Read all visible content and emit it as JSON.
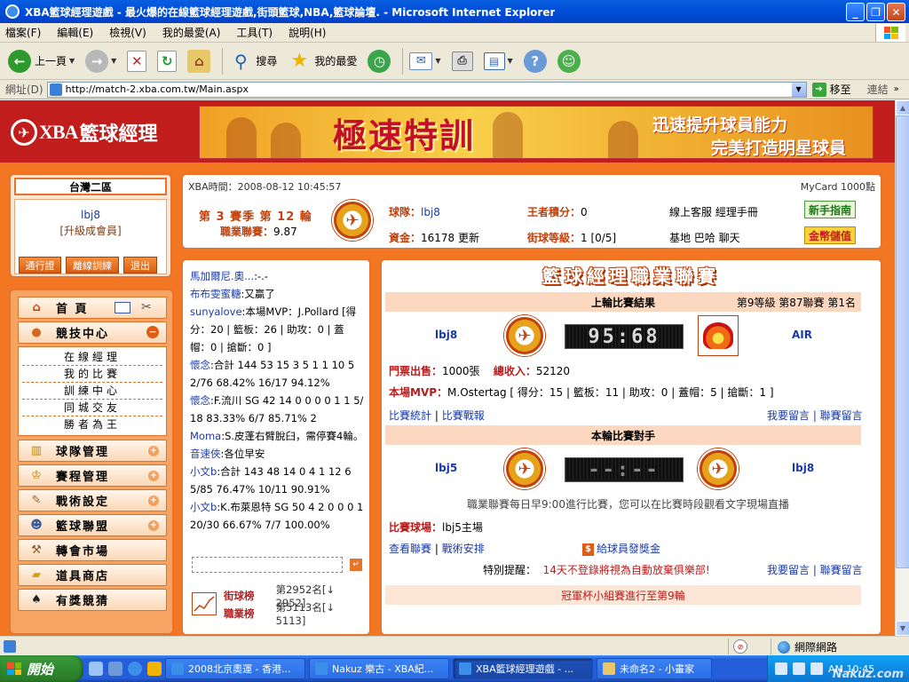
{
  "window": {
    "title": "XBA籃球經理遊戲 - 最火爆的在線籃球經理遊戲,街頭籃球,NBA,籃球論壇. - Microsoft Internet Explorer",
    "controls": [
      "_",
      "❐",
      "✕"
    ]
  },
  "menu": [
    "檔案(F)",
    "編輯(E)",
    "檢視(V)",
    "我的最愛(A)",
    "工具(T)",
    "說明(H)"
  ],
  "toolbar": {
    "back": "上一頁",
    "search": "搜尋",
    "favorites": "我的最愛"
  },
  "address": {
    "label": "網址(D)",
    "url": "http://match-2.xba.com.tw/Main.aspx",
    "go": "移至",
    "links": "連結"
  },
  "banner": {
    "logo_a": "XBA",
    "logo_b": "籃球經理",
    "ad_title": "極速特訓",
    "ad_line1": "迅速提升球員能力",
    "ad_line2": "完美打造明星球員"
  },
  "user": {
    "server": "台灣二區",
    "name": "lbj8",
    "level": "[升級成會員]",
    "buttons": [
      "通行證",
      "離線訓練",
      "退出"
    ]
  },
  "nav": {
    "home": "首 頁",
    "arena": "競技中心",
    "sub": [
      "在線經理",
      "我的比賽",
      "訓練中心",
      "同城交友",
      "勝者為王"
    ],
    "items": [
      "球隊管理",
      "賽程管理",
      "戰術設定",
      "籃球聯盟",
      "轉會市場",
      "道具商店",
      "有獎競猜"
    ]
  },
  "info": {
    "time": "XBA時間：2008-08-12 10:45:57",
    "mycard": "MyCard 1000點",
    "season": "第 3 賽季  第 12 輪",
    "career_label": "職業聯賽：",
    "career_value": "9.87",
    "team_label": "球隊：",
    "team_value": "lbj8",
    "king_label": "王者積分：",
    "king_value": "0",
    "cs": "線上客服  經理手冊",
    "guide_btn": "新手指南",
    "money_label": "資金：",
    "money_value": "16178 更新",
    "street_label": "街球等級：",
    "street_value": "1 [0/5]",
    "base": "基地  巴哈  聊天",
    "gold_btn": "金幣儲值"
  },
  "chat": {
    "messages": [
      {
        "name": "馬加爾尼.奧...",
        "text": ":-.-"
      },
      {
        "name": "布布雯蜜糖",
        "text": ":又贏了"
      },
      {
        "name": "sunyalove",
        "text": ":本場MVP：J.Pollard [得分：20 | 籃板：26 | 助攻：0 | 蓋帽：0 | 搶斷：0 ]"
      },
      {
        "name": "懷念",
        "text": ":合計  144 53 15 3 5 1 1 10 52/76 68.42% 16/17 94.12%"
      },
      {
        "name": "懷念",
        "text": ":F.流川  SG 42 14 0 0 0 0 1 1 5/18 83.33% 6/7 85.71% 2"
      },
      {
        "name": "Moma",
        "text": ":S.皮蓬右臂脫臼，需停賽4輪。"
      },
      {
        "name": "音速俠",
        "text": ":各位早安"
      },
      {
        "name": "小文b",
        "text": ":合計  143 48 14 0 4 1 12 6 5/85 76.47% 10/11 90.91%"
      },
      {
        "name": "小文b",
        "text": ":K.布萊恩特  SG 50 4 2 0 0 0 1 20/30 66.67% 7/7 100.00%"
      }
    ],
    "street_rank_label": "街球榜",
    "street_rank_value": "第2952名[↓ 2952]",
    "pro_rank_label": "職業榜",
    "pro_rank_value": "第5113名[↓ 5113]"
  },
  "league": {
    "title": "籃球經理職業聯賽",
    "last_title": "上輪比賽結果",
    "last_right": "第9等級  第87聯賽  第1名",
    "home_team": "lbj8",
    "away_team": "AIR",
    "score": "95:68",
    "ticket_label": "門票出售：",
    "ticket_value": "1000張",
    "income_label": "總收入：",
    "income_value": "52120",
    "mvp_label": "本場MVP：",
    "mvp_value": "M.Ostertag  [ 得分：15 | 籃板：11 | 助攻：0 | 蓋帽：5 | 搶斷：1 ]",
    "stats_link": "比賽統計",
    "report_link": "比賽戰報",
    "msg_links": "我要留言 | 聯賽留言",
    "next_title": "本輪比賽對手",
    "next_home": "lbj5",
    "next_away": "lbj8",
    "next_score": "--:--",
    "notice": "職業聯賽每日早9:00進行比賽，您可以在比賽時段觀看文字現場直播",
    "arena_label": "比賽球場：",
    "arena_value": "lbj5主場",
    "view_link": "查看聯賽",
    "tactic_link": "戰術安排",
    "bonus_link": "給球員發獎金",
    "reminder_label": "特別提醒：",
    "reminder_value": "14天不登錄將視為自動放棄俱樂部!",
    "msg_links2": "我要留言 | 聯賽留言",
    "cup": "冠軍杯小組賽進行至第9輪"
  },
  "status": {
    "network": "網際網路"
  },
  "taskbar": {
    "start": "開始",
    "tasks": [
      "2008北京奧運 - 香港...",
      "Nakuz 樂古 - XBA紀...",
      "XBA籃球經理遊戲 - ...",
      "未命名2 - 小畫家"
    ],
    "clock": "AM 10:45",
    "watermark": "Nakuz.com"
  }
}
